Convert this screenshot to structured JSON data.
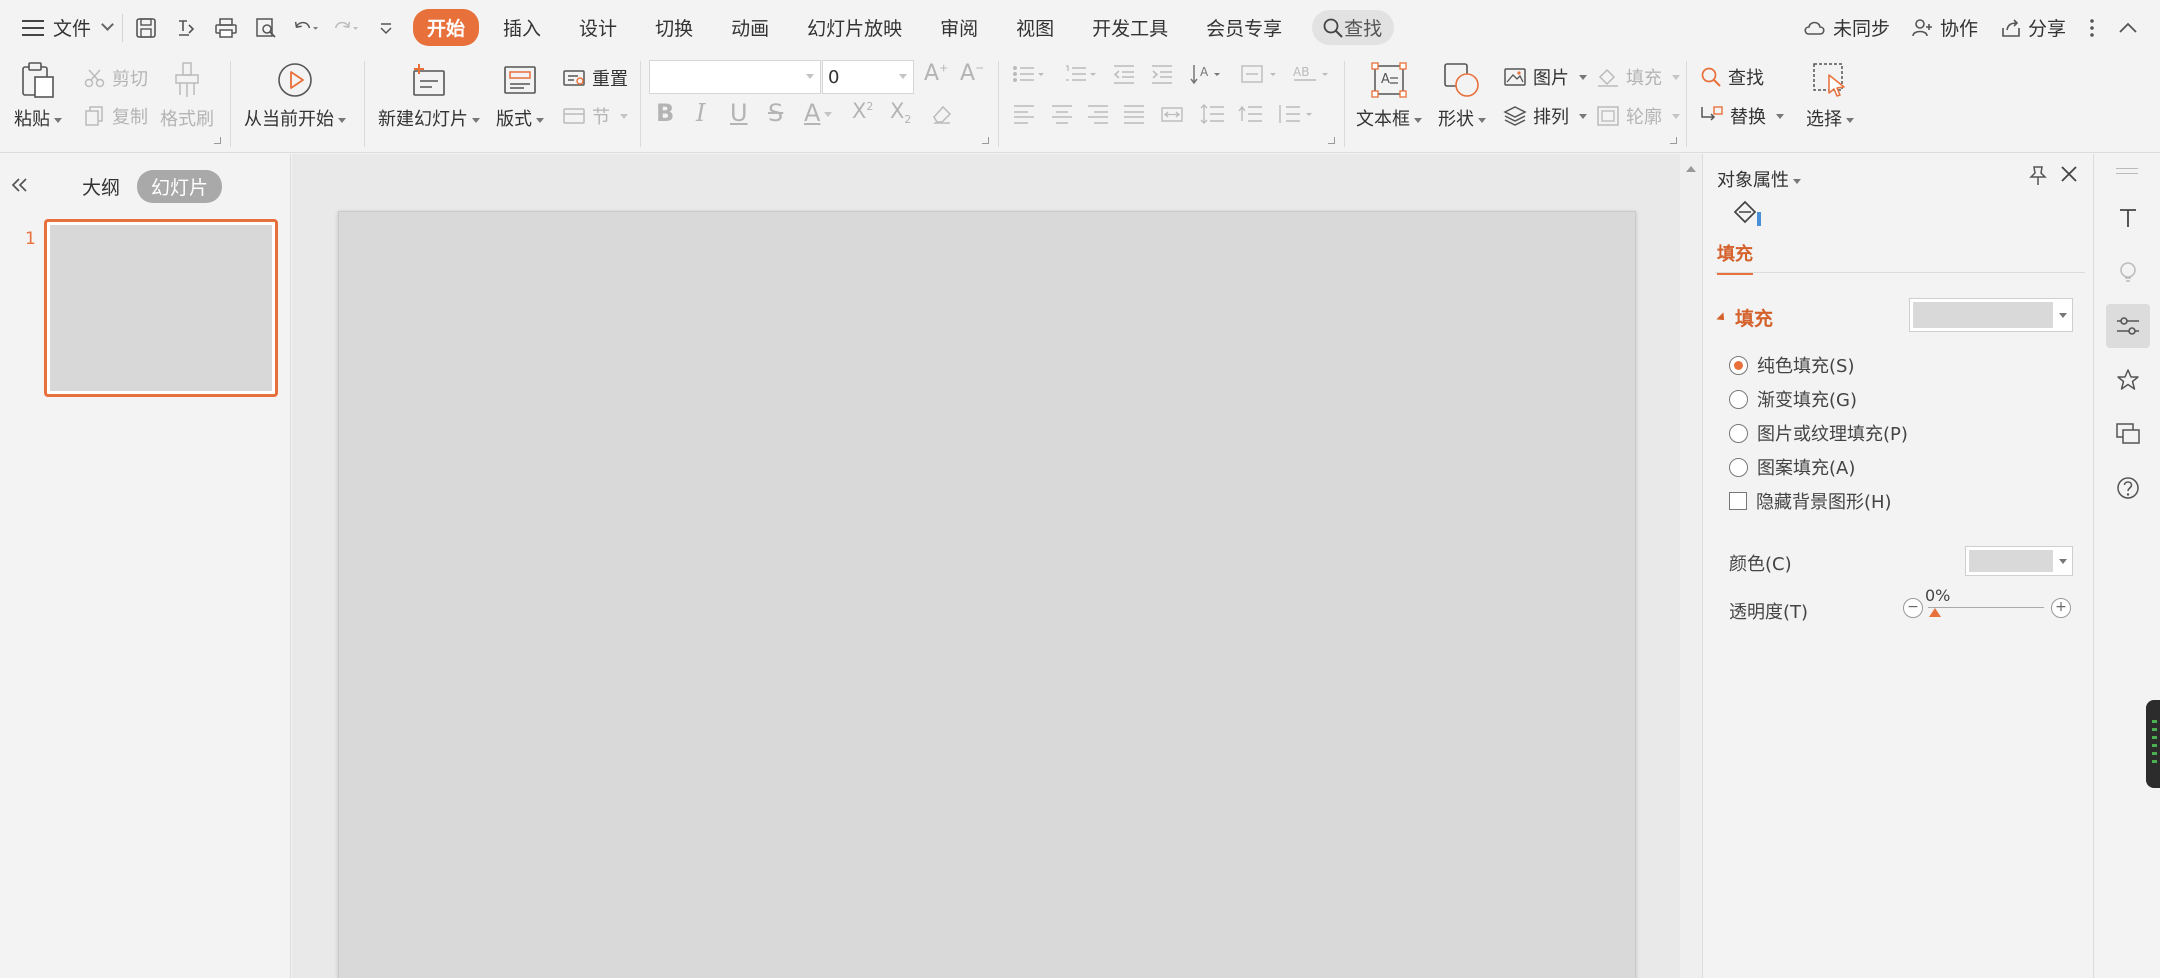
{
  "menubar": {
    "file_label": "文件",
    "tabs": [
      {
        "label": "开始",
        "active": true
      },
      {
        "label": "插入"
      },
      {
        "label": "设计"
      },
      {
        "label": "切换"
      },
      {
        "label": "动画"
      },
      {
        "label": "幻灯片放映"
      },
      {
        "label": "审阅"
      },
      {
        "label": "视图"
      },
      {
        "label": "开发工具"
      },
      {
        "label": "会员专享"
      }
    ],
    "search_label": "查找",
    "sync_label": "未同步",
    "collab_label": "协作",
    "share_label": "分享"
  },
  "ribbon": {
    "paste": "粘贴",
    "cut": "剪切",
    "copy": "复制",
    "format_painter": "格式刷",
    "play_from_current": "从当前开始",
    "new_slide": "新建幻灯片",
    "layout": "版式",
    "reset": "重置",
    "section": "节",
    "font_size_value": "0",
    "fill": "填充",
    "picture": "图片",
    "arrange": "排列",
    "outline": "轮廓",
    "textbox": "文本框",
    "shape": "形状",
    "find": "查找",
    "replace": "替换",
    "select": "选择"
  },
  "leftpanel": {
    "outline_tab": "大纲",
    "slides_tab": "幻灯片",
    "slide_number": "1"
  },
  "props": {
    "title": "对象属性",
    "fill_tab": "填充",
    "section_fill": "填充",
    "options": [
      {
        "label": "纯色填充(S)",
        "checked": true
      },
      {
        "label": "渐变填充(G)",
        "checked": false
      },
      {
        "label": "图片或纹理填充(P)",
        "checked": false
      },
      {
        "label": "图案填充(A)",
        "checked": false
      }
    ],
    "hide_bg_label": "隐藏背景图形(H)",
    "color_label": "颜色(C)",
    "transparency_label": "透明度(T)",
    "transparency_value": "0%",
    "fill_color": "#d9d9d9"
  },
  "colors": {
    "accent": "#e8703a",
    "slide_bg": "#d9d9d9"
  }
}
